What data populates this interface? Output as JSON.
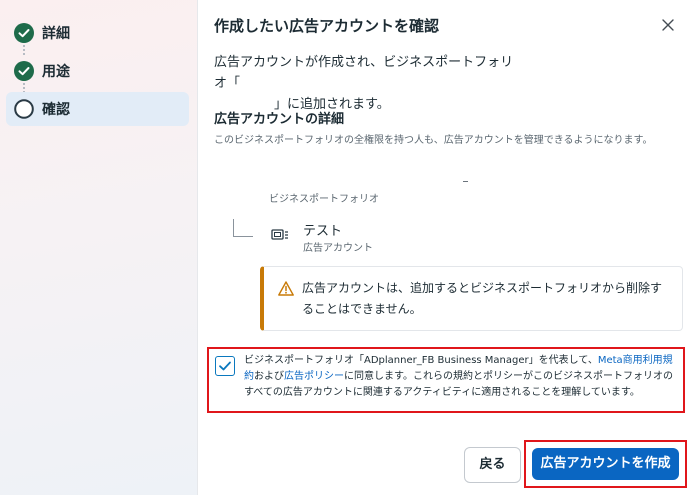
{
  "steps": [
    {
      "label": "詳細",
      "state": "done"
    },
    {
      "label": "用途",
      "state": "done"
    },
    {
      "label": "確認",
      "state": "current"
    }
  ],
  "dialog": {
    "title": "作成したい広告アカウントを確認",
    "desc_line1": "広告アカウントが作成され、ビジネスポートフォリオ「",
    "desc_line2": "」に追加されます。",
    "details_title": "広告アカウントの詳細",
    "details_sub": "このビジネスポートフォリオの全権限を持つ人も、広告アカウントを管理できるようになります。",
    "portfolio_label": "ビジネスポートフォリオ",
    "account": {
      "name": "テスト",
      "type": "広告アカウント"
    },
    "warning": "広告アカウントは、追加するとビジネスポートフォリオから削除することはできません。",
    "consent": {
      "checked": true,
      "text_part1": "ビジネスポートフォリオ「ADplanner_FB Business Manager」を代表して、",
      "link1": "Meta商用利用規約",
      "text_part2": "および",
      "link2": "広告ポリシー",
      "text_part3": "に同意します。これらの規約とポリシーがこのビジネスポートフォリオのすべての広告アカウントに関連するアクティビティに適用されることを理解しています。"
    },
    "back_label": "戻る",
    "create_label": "広告アカウントを作成"
  },
  "colors": {
    "accent": "#0a66c2",
    "done_check": "#1e6b4a",
    "warning": "#c87a07",
    "highlight": "#e0161b"
  },
  "icons": [
    "check-circle-icon",
    "empty-circle-icon",
    "close-icon",
    "ad-account-icon",
    "warning-icon",
    "checkmark-icon"
  ]
}
